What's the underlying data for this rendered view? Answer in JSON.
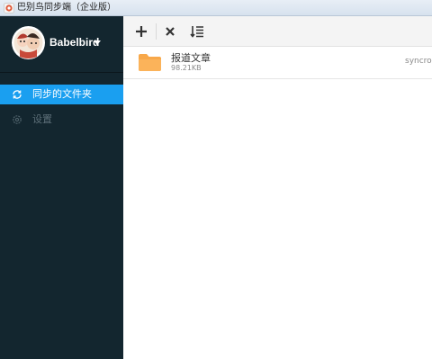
{
  "window": {
    "title": "巴别鸟同步端（企业版）"
  },
  "sidebar": {
    "user": {
      "name": "Babelbird"
    },
    "items": [
      {
        "label": "同步的文件夹",
        "icon": "sync-icon",
        "active": true
      },
      {
        "label": "设置",
        "icon": "gear-icon",
        "active": false
      }
    ]
  },
  "toolbar": {
    "buttons": [
      {
        "icon": "plus-icon",
        "tooltip": "add"
      },
      {
        "icon": "close-icon",
        "tooltip": "remove"
      },
      {
        "icon": "sort-icon",
        "tooltip": "sort"
      }
    ]
  },
  "files": [
    {
      "name": "报道文章",
      "size": "98.21KB",
      "status": "syncron"
    }
  ],
  "colors": {
    "sidebar_bg": "#13262f",
    "active_item": "#1a9ff0",
    "folder": "#f8a84a"
  }
}
